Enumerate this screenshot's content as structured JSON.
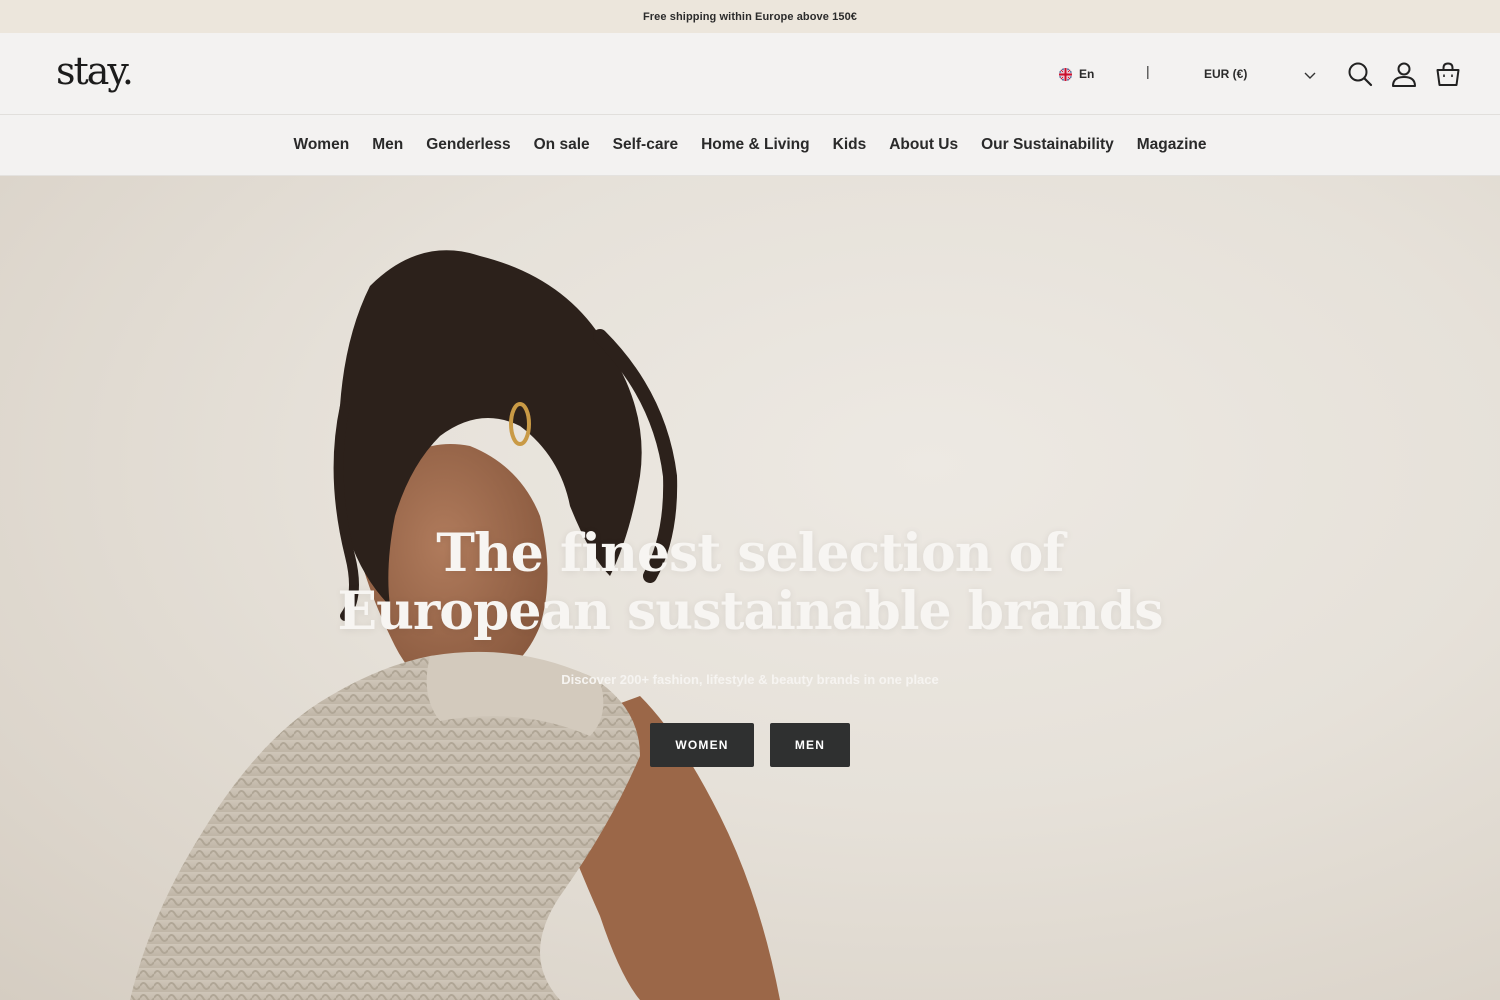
{
  "announcement": "Free shipping within Europe above 150€",
  "header": {
    "logo": "stay.",
    "language": "En",
    "separator": "|",
    "currency": "EUR (€)",
    "icons": {
      "search": "search-icon",
      "account": "user-icon",
      "cart": "shopping-bag-icon",
      "chevron": "chevron-down-icon",
      "flag": "uk-flag-icon"
    }
  },
  "nav": {
    "items": [
      "Women",
      "Men",
      "Genderless",
      "On sale",
      "Self-care",
      "Home & Living",
      "Kids",
      "About Us",
      "Our Sustainability",
      "Magazine"
    ]
  },
  "hero": {
    "title_line1": "The finest selection of",
    "title_line2": "European sustainable brands",
    "subtitle": "Discover 200+ fashion, lifestyle & beauty brands in one place",
    "buttons": {
      "women": "WOMEN",
      "men": "MEN"
    }
  },
  "colors": {
    "announcement_bg": "#ece6dc",
    "header_bg": "#f3f2f1",
    "button_bg": "#2f3030"
  }
}
